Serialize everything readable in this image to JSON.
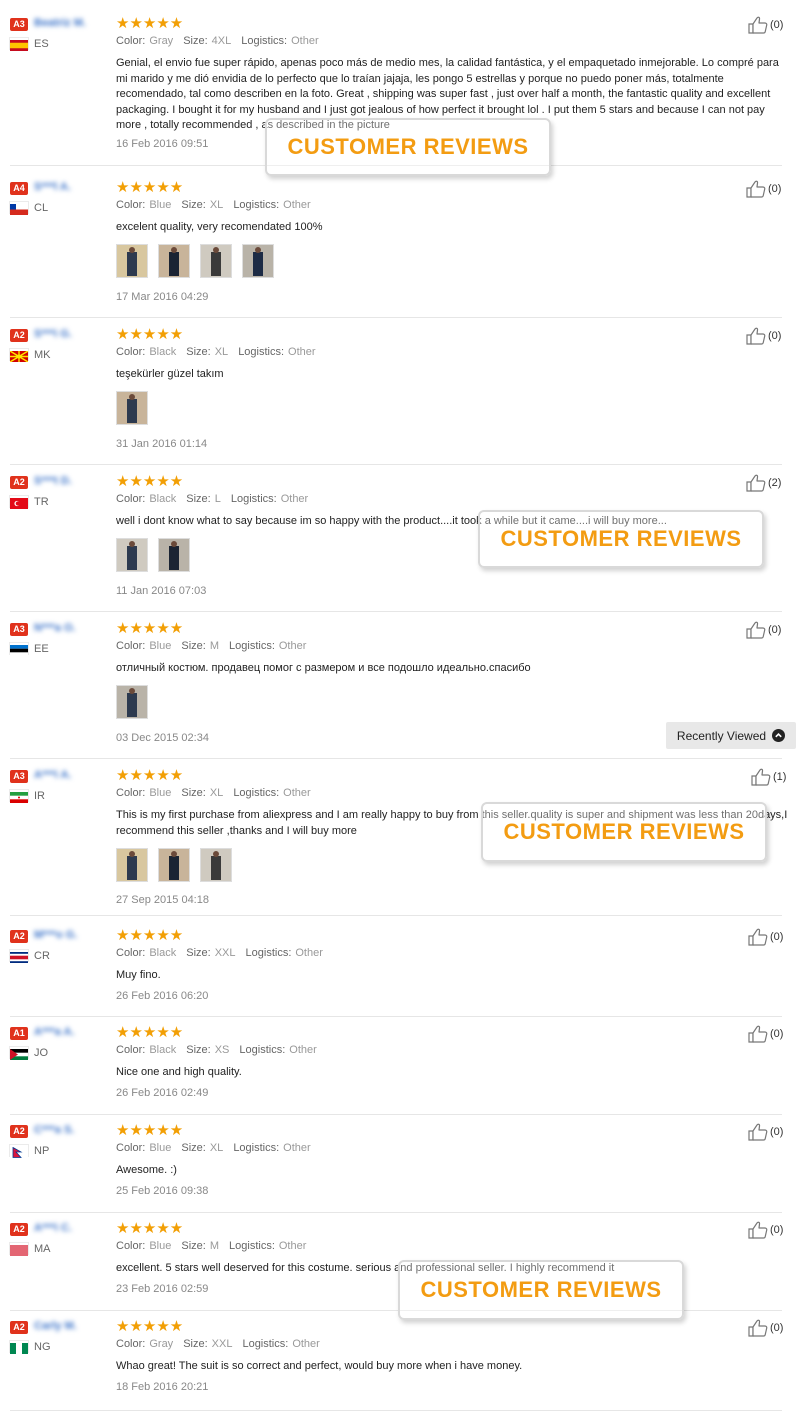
{
  "labels": {
    "color": "Color:",
    "size": "Size:",
    "logistics": "Logistics:"
  },
  "recently_viewed": "Recently Viewed",
  "watermark_text": "CUSTOMER REVIEWS",
  "colors": {
    "star": "#f29f05",
    "badge": "#e0321c",
    "watermark": "#f39c12"
  },
  "reviews": [
    {
      "badge": "A3",
      "name": "Beatriz M.",
      "country": "ES",
      "stars": "★★★★★",
      "color": "Gray",
      "size": "4XL",
      "logistics": "Other",
      "likes": "(0)",
      "text": "Genial, el envio fue super rápido, apenas poco más de medio mes, la calidad fantástica, y el empaquetado inmejorable. Lo compré para mi marido y me dió envidia de lo perfecto que lo traían jajaja, les pongo 5 estrellas y porque no puedo poner más, totalmente recomendado, tal como describen en la foto. Great , shipping was super fast , just over half a month, the fantastic quality and excellent packaging. I bought it for my husband and I just got jealous of how perfect it brought lol . I put them 5 stars and because I can not pay more , totally recommended , as described in the picture",
      "date": "16 Feb 2016 09:51",
      "photos": []
    },
    {
      "badge": "A4",
      "name": "S***l A.",
      "country": "CL",
      "stars": "★★★★★",
      "color": "Blue",
      "size": "XL",
      "logistics": "Other",
      "likes": "(0)",
      "text": "excelent quality, very recomendated 100%",
      "date": "17 Mar 2016 04:29",
      "photos": [
        "photo",
        "photo",
        "photo",
        "photo"
      ]
    },
    {
      "badge": "A2",
      "name": "S***i G.",
      "country": "MK",
      "stars": "★★★★★",
      "color": "Black",
      "size": "XL",
      "logistics": "Other",
      "likes": "(0)",
      "text": "teşekürler güzel takım",
      "date": "31 Jan 2016 01:14",
      "photos": [
        "photo"
      ]
    },
    {
      "badge": "A2",
      "name": "S***t D.",
      "country": "TR",
      "stars": "★★★★★",
      "color": "Black",
      "size": "L",
      "logistics": "Other",
      "likes": "(2)",
      "text": "well i dont know what to say because im so happy with the product....it took a while but it came....i will buy more...",
      "date": "11 Jan 2016 07:03",
      "photos": [
        "photo",
        "photo"
      ]
    },
    {
      "badge": "A3",
      "name": "N***a O.",
      "country": "EE",
      "stars": "★★★★★",
      "color": "Blue",
      "size": "M",
      "logistics": "Other",
      "likes": "(0)",
      "text": "отличный костюм. продавец помог с размером и все подошло идеально.спасибо",
      "date": "03 Dec 2015 02:34",
      "photos": [
        "photo"
      ]
    },
    {
      "badge": "A3",
      "name": "A***i A.",
      "country": "IR",
      "stars": "★★★★★",
      "color": "Blue",
      "size": "XL",
      "logistics": "Other",
      "likes": "(1)",
      "text": "This is my first purchase from aliexpress and I am really happy to buy from this seller.quality is super and shipment was less than 20days,I recommend this seller ,thanks and I will buy more",
      "date": "27 Sep 2015 04:18",
      "photos": [
        "photo",
        "photo",
        "photo"
      ]
    },
    {
      "badge": "A2",
      "name": "M***o G.",
      "country": "CR",
      "stars": "★★★★★",
      "color": "Black",
      "size": "XXL",
      "logistics": "Other",
      "likes": "(0)",
      "text": "Muy fino.",
      "date": "26 Feb 2016 06:20",
      "photos": []
    },
    {
      "badge": "A1",
      "name": "A***a A.",
      "country": "JO",
      "stars": "★★★★★",
      "color": "Black",
      "size": "XS",
      "logistics": "Other",
      "likes": "(0)",
      "text": "Nice one and high quality.",
      "date": "26 Feb 2016 02:49",
      "photos": []
    },
    {
      "badge": "A2",
      "name": "C***a S.",
      "country": "NP",
      "stars": "★★★★★",
      "color": "Blue",
      "size": "XL",
      "logistics": "Other",
      "likes": "(0)",
      "text": "Awesome. :)",
      "date": "25 Feb 2016 09:38",
      "photos": []
    },
    {
      "badge": "A2",
      "name": "A***i C.",
      "country": "MA",
      "stars": "★★★★★",
      "color": "Blue",
      "size": "M",
      "logistics": "Other",
      "likes": "(0)",
      "text": "excellent. 5 stars well deserved for this costume. serious and professional seller. I highly recommend it",
      "date": "23 Feb 2016 02:59",
      "photos": []
    },
    {
      "badge": "A2",
      "name": "Carly M.",
      "country": "NG",
      "stars": "★★★★★",
      "color": "Gray",
      "size": "XXL",
      "logistics": "Other",
      "likes": "(0)",
      "text": "Whao great! The suit is so correct and perfect, would buy more when i have money.",
      "date": "18 Feb 2016 20:21",
      "photos": []
    }
  ]
}
